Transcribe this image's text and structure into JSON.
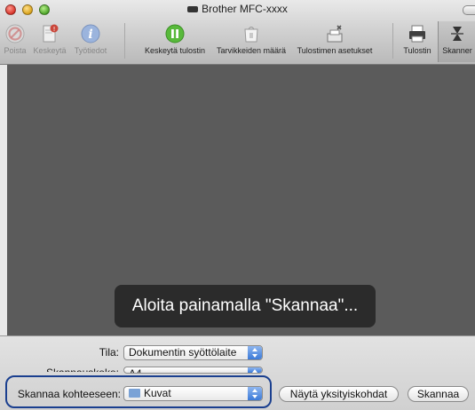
{
  "window": {
    "title": "Brother MFC-xxxx"
  },
  "toolbar": {
    "items": [
      {
        "label": "Poista",
        "icon": "delete-icon",
        "enabled": false
      },
      {
        "label": "Keskeytä",
        "icon": "hold-icon",
        "enabled": false
      },
      {
        "label": "Työtiedot",
        "icon": "info-icon",
        "enabled": false
      },
      {
        "label": "Keskeytä tulostin",
        "icon": "pause-icon",
        "enabled": true
      },
      {
        "label": "Tarvikkeiden määrä",
        "icon": "supply-levels-icon",
        "enabled": true
      },
      {
        "label": "Tulostimen asetukset",
        "icon": "printer-setup-icon",
        "enabled": true
      },
      {
        "label": "Tulostin",
        "icon": "printer-icon",
        "enabled": true
      },
      {
        "label": "Skanner",
        "icon": "scanner-icon",
        "enabled": true
      }
    ]
  },
  "preview": {
    "message": "Aloita painamalla \"Skannaa\"..."
  },
  "controls": {
    "mode_label": "Tila:",
    "mode_value": "Dokumentin syöttölaite",
    "size_label": "Skannauskoko:",
    "size_value": "A4",
    "destination_label": "Skannaa kohteeseen:",
    "destination_value": "Kuvat",
    "details_button": "Näytä yksityiskohdat",
    "scan_button": "Skannaa"
  },
  "colors": {
    "accent": "#3b7ad8",
    "highlight": "#1a3f8f",
    "preview_bg": "#5b5b5b"
  }
}
